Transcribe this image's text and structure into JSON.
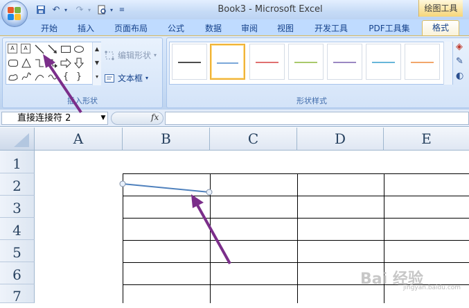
{
  "window": {
    "title": "Book3 - Microsoft Excel",
    "contextual_tab": "绘图工具"
  },
  "quick_access": {
    "save_icon": "save-icon",
    "undo_icon": "undo-icon",
    "redo_icon": "redo-icon",
    "print_preview_icon": "print-preview-icon"
  },
  "ribbon": {
    "tabs": [
      "开始",
      "插入",
      "页面布局",
      "公式",
      "数据",
      "审阅",
      "视图",
      "开发工具",
      "PDF工具集",
      "格式"
    ],
    "active_tab": "格式",
    "insert_shapes_group": {
      "label": "插入形状",
      "edit_shape_label": "编辑形状",
      "textbox_label": "文本框"
    },
    "shape_styles_group": {
      "label": "形状样式",
      "swatches": [
        {
          "color": "#4d4d4d",
          "selected": false
        },
        {
          "color": "#7aa7d9",
          "selected": true
        },
        {
          "color": "#e07070",
          "selected": false
        },
        {
          "color": "#a9c96b",
          "selected": false
        },
        {
          "color": "#9b88c2",
          "selected": false
        },
        {
          "color": "#67b6d9",
          "selected": false
        },
        {
          "color": "#f2a66a",
          "selected": false
        }
      ]
    }
  },
  "formula_bar": {
    "name_box": "直接连接符 2",
    "fx_label": "fx",
    "formula": ""
  },
  "sheet": {
    "columns": [
      "A",
      "B",
      "C",
      "D",
      "E"
    ],
    "rows": [
      "1",
      "2",
      "3",
      "4",
      "5",
      "6",
      "7"
    ]
  },
  "watermark": {
    "text": "Bai 经验",
    "sub": "jingyan.baidu.com"
  },
  "colors": {
    "annotation_arrow": "#7b2e8a",
    "connector_line": "#4f81bd",
    "grid_border": "#000000"
  }
}
